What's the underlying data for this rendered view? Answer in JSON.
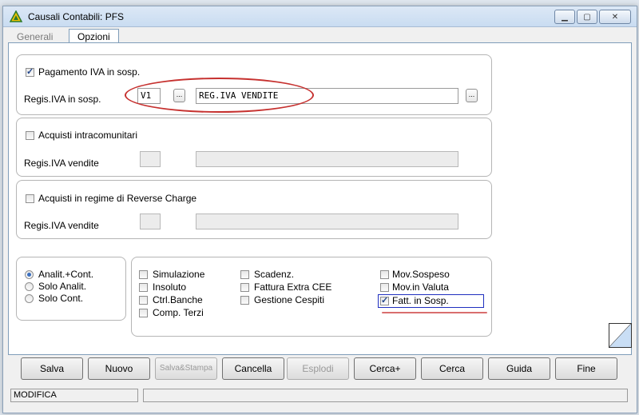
{
  "window": {
    "title": "Causali Contabili: PFS"
  },
  "tabs": [
    {
      "label": "Generali"
    },
    {
      "label": "Opzioni"
    }
  ],
  "group_iva_sosp": {
    "checkbox_label": "Pagamento IVA in sosp.",
    "checked": true,
    "field_label": "Regis.IVA in sosp.",
    "code_value": "V1",
    "desc_value": "REG.IVA VENDITE",
    "lookup_label": "..."
  },
  "group_intracom": {
    "checkbox_label": "Acquisti intracomunitari",
    "field_label": "Regis.IVA vendite"
  },
  "group_reverse": {
    "checkbox_label": "Acquisti in regime di Reverse Charge",
    "field_label": "Regis.IVA vendite"
  },
  "radio_options": [
    {
      "label": "Analit.+Cont.",
      "selected": true
    },
    {
      "label": "Solo Analit.",
      "selected": false
    },
    {
      "label": "Solo Cont.",
      "selected": false
    }
  ],
  "checks": {
    "simulazione": "Simulazione",
    "insoluto": "Insoluto",
    "ctrl_banche": "Ctrl.Banche",
    "comp_terzi": "Comp. Terzi",
    "scadenz": "Scadenz.",
    "fattura_extra_cee": "Fattura Extra CEE",
    "gestione_cespiti": "Gestione Cespiti",
    "mov_sospeso": "Mov.Sospeso",
    "mov_in_valuta": "Mov.in Valuta",
    "fatt_in_sosp": "Fatt. in Sosp."
  },
  "buttons": {
    "salva": "Salva",
    "nuovo": "Nuovo",
    "salva_stampa": "Salva&Stampa",
    "cancella": "Cancella",
    "esplodi": "Esplodi",
    "cerca_plus": "Cerca+",
    "cerca": "Cerca",
    "guida": "Guida",
    "fine": "Fine"
  },
  "status": {
    "mode": "MODIFICA",
    "message": ""
  },
  "colors": {
    "annotation_red": "#c6312f",
    "focus_blue": "#1f2fbf"
  }
}
